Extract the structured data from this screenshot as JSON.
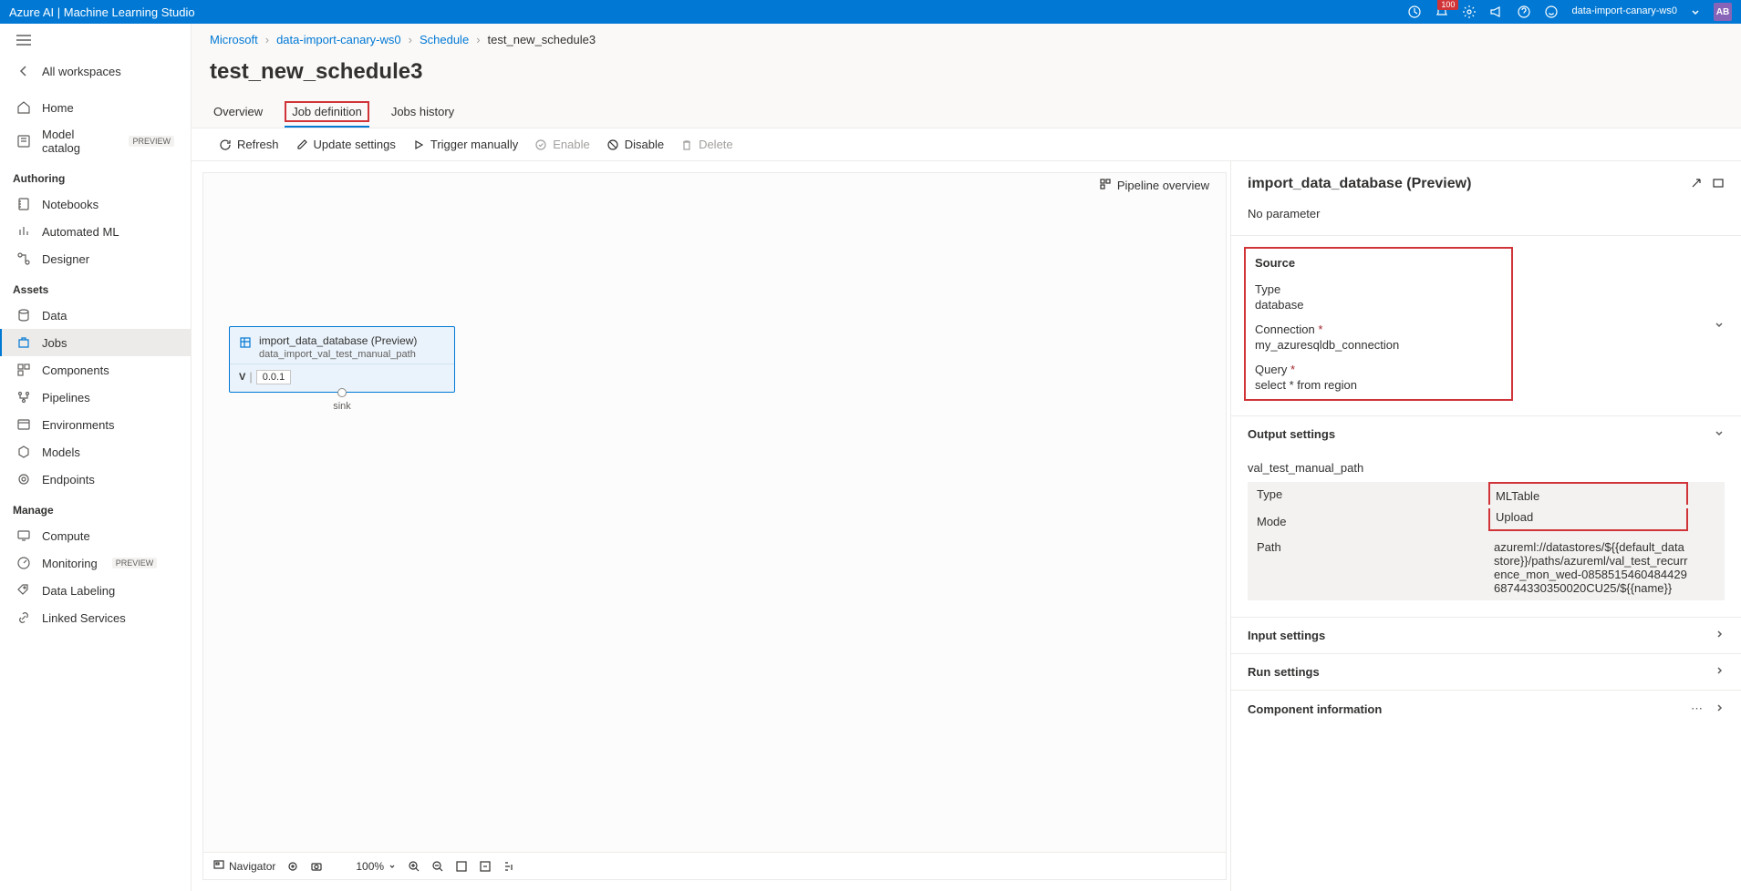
{
  "header": {
    "title": "Azure AI | Machine Learning Studio",
    "badge_count": "100",
    "workspace_line2": "data-import-canary-ws0",
    "avatar_initials": "AB"
  },
  "sidebar": {
    "hamburger_label": "menu",
    "all_workspaces": "All workspaces",
    "nav_home": "Home",
    "nav_model_catalog": "Model catalog",
    "preview_tag": "PREVIEW",
    "section_authoring": "Authoring",
    "nav_notebooks": "Notebooks",
    "nav_automl": "Automated ML",
    "nav_designer": "Designer",
    "section_assets": "Assets",
    "nav_data": "Data",
    "nav_jobs": "Jobs",
    "nav_components": "Components",
    "nav_pipelines": "Pipelines",
    "nav_environments": "Environments",
    "nav_models": "Models",
    "nav_endpoints": "Endpoints",
    "section_manage": "Manage",
    "nav_compute": "Compute",
    "nav_monitoring": "Monitoring",
    "nav_datalabeling": "Data Labeling",
    "nav_linkedservices": "Linked Services"
  },
  "breadcrumb": {
    "item1": "Microsoft",
    "item2": "data-import-canary-ws0",
    "item3": "Schedule",
    "item4": "test_new_schedule3"
  },
  "page_title": "test_new_schedule3",
  "tabs": {
    "overview": "Overview",
    "job_definition": "Job definition",
    "jobs_history": "Jobs history"
  },
  "toolbar": {
    "refresh": "Refresh",
    "update_settings": "Update settings",
    "trigger_manually": "Trigger manually",
    "enable": "Enable",
    "disable": "Disable",
    "delete": "Delete"
  },
  "pipeline_overview": "Pipeline overview",
  "node": {
    "title": "import_data_database (Preview)",
    "subtitle": "data_import_val_test_manual_path",
    "v_label": "V",
    "version": "0.0.1",
    "port_label": "sink"
  },
  "canvas_footer": {
    "navigator": "Navigator",
    "zoom": "100%"
  },
  "right_panel": {
    "title": "import_data_database (Preview)",
    "no_parameter": "No parameter",
    "section_source": "Source",
    "source_type_label": "Type",
    "source_type_value": "database",
    "source_connection_label": "Connection",
    "source_connection_value": "my_azuresqldb_connection",
    "source_query_label": "Query",
    "source_query_value": "select * from region",
    "section_output": "Output settings",
    "output_name": "val_test_manual_path",
    "output_type_key": "Type",
    "output_type_val": "MLTable",
    "output_mode_key": "Mode",
    "output_mode_val": "Upload",
    "output_path_key": "Path",
    "output_path_val": "azureml://datastores/${{default_datastore}}/paths/azureml/val_test_recurrence_mon_wed-085851546048442968744330350020CU25/${{name}}",
    "section_input": "Input settings",
    "section_run": "Run settings",
    "section_component": "Component information"
  }
}
